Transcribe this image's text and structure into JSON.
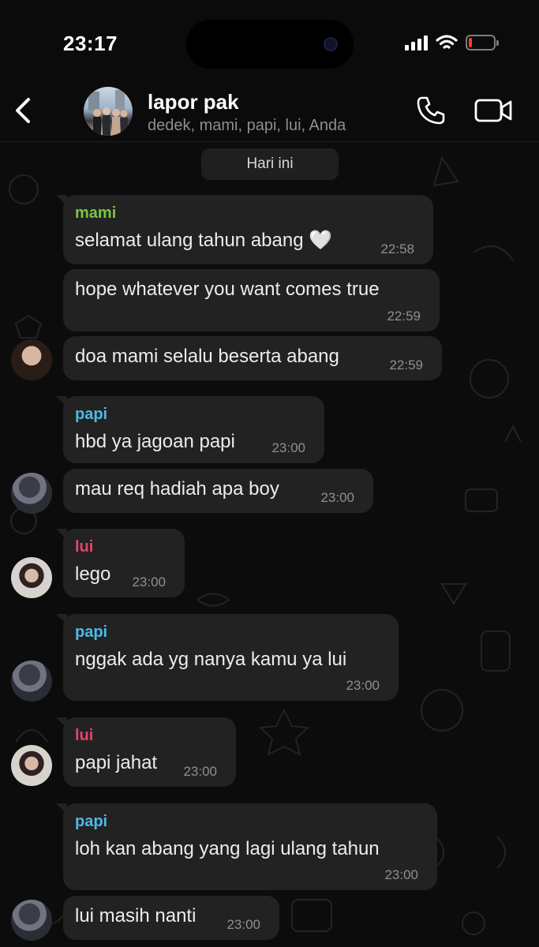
{
  "status_bar": {
    "time": "23:17",
    "battery_level": 0.12,
    "battery_color": "#ff3b30"
  },
  "header": {
    "title": "lapor pak",
    "members": "dedek, mami, papi, lui, Anda",
    "back_icon": "chevron-left-icon",
    "call_icon": "phone-icon",
    "video_icon": "video-camera-icon"
  },
  "colors": {
    "mami": "#7bc442",
    "papi": "#4fb8e8",
    "lui": "#e8426b",
    "bubble": "#222222"
  },
  "chat": {
    "date_chip": "Hari ini",
    "messages": [
      {
        "sender": "mami",
        "text": "selamat ulang tahun abang 🤍",
        "time": "22:58"
      },
      {
        "sender": "",
        "text": "hope whatever you want comes true",
        "time": "22:59"
      },
      {
        "sender": "",
        "text": "doa mami selalu beserta abang",
        "time": "22:59"
      },
      {
        "sender": "papi",
        "text": "hbd ya jagoan papi",
        "time": "23:00"
      },
      {
        "sender": "",
        "text": "mau req hadiah apa boy",
        "time": "23:00"
      },
      {
        "sender": "lui",
        "text": "lego",
        "time": "23:00"
      },
      {
        "sender": "papi",
        "text": "nggak ada yg nanya kamu ya lui",
        "time": "23:00"
      },
      {
        "sender": "lui",
        "text": "papi jahat",
        "time": "23:00"
      },
      {
        "sender": "papi",
        "text": "loh kan abang yang lagi ulang tahun",
        "time": "23:00"
      },
      {
        "sender": "",
        "text": "lui masih nanti",
        "time": "23:00"
      }
    ]
  }
}
